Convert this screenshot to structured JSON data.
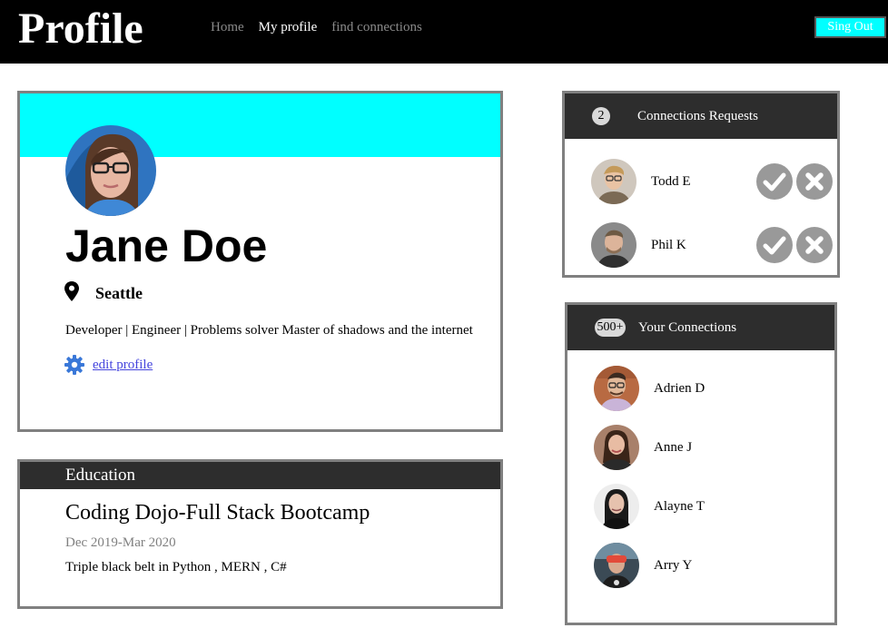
{
  "header": {
    "brand": "Profile",
    "nav": [
      {
        "label": "Home",
        "active": false
      },
      {
        "label": "My profile",
        "active": true
      },
      {
        "label": "find connections",
        "active": false
      }
    ],
    "signout_label": "Sing Out"
  },
  "profile": {
    "name": "Jane Doe",
    "location": "Seattle",
    "bio": "Developer | Engineer | Problems solver Master of shadows and the internet",
    "edit_label": "edit profile",
    "icons": {
      "location": "map-pin-icon",
      "settings": "gear-icon"
    }
  },
  "education": {
    "heading": "Education",
    "school": "Coding Dojo-Full Stack Bootcamp",
    "dates": "Dec 2019-Mar 2020",
    "description": "Triple black belt in Python , MERN , C#"
  },
  "requests": {
    "count": "2",
    "title": "Connections Requests",
    "items": [
      {
        "name": "Todd E"
      },
      {
        "name": "Phil K"
      }
    ],
    "icons": {
      "accept": "check-icon",
      "decline": "close-icon"
    }
  },
  "connections": {
    "count": "500+",
    "title": "Your Connections",
    "items": [
      {
        "name": "Adrien D"
      },
      {
        "name": "Anne J"
      },
      {
        "name": "Alayne T"
      },
      {
        "name": "Arry Y"
      }
    ]
  },
  "colors": {
    "accent": "#00ffff",
    "topbar": "#000000",
    "panel_header": "#2d2d2d",
    "card_border": "#808080",
    "action_button": "#999999",
    "link": "#4444dd",
    "gear": "#3a78d8"
  }
}
